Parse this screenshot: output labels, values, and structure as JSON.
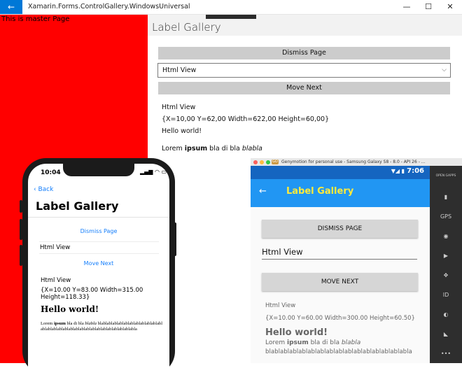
{
  "window": {
    "back_glyph": "←",
    "title": "Xamarin.Forms.ControlGallery.WindowsUniversal",
    "minimize_glyph": "—",
    "maximize_glyph": "☐",
    "close_glyph": "✕"
  },
  "master": {
    "text": "This is master Page"
  },
  "detail": {
    "title": "Label Gallery",
    "dismiss_label": "Dismiss Page",
    "picker_value": "Html View",
    "picker_chevron": "⌵",
    "next_label": "Move Next",
    "label_title": "Html View",
    "label_bounds": "{X=10,00 Y=62,00 Width=622,00 Height=60,00}",
    "hello": "Hello world!",
    "lorem_pre": "Lorem ",
    "lorem_bold": "ipsum",
    "lorem_mid": " bla di bla ",
    "lorem_italic": "blabla"
  },
  "ios": {
    "time": "10:04",
    "status_icons": "▂▄▆ ◠ ▭",
    "back_label": "‹ Back",
    "title": "Label Gallery",
    "dismiss_label": "Dismiss Page",
    "picker_value": "Html View",
    "next_label": "Move Next",
    "label_title": "Html View",
    "label_bounds_1": "{X=10.00 Y=83.00 Width=315.00",
    "label_bounds_2": "Height=118.33}",
    "hello": "Hello world!",
    "lorem_pre": "Lorem ",
    "lorem_bold": "ipsum",
    "lorem_mid": " bla di bla ",
    "lorem_italic": "blabla",
    "bla_line": "blablablablablablablablablablablablablablablablablablablablablablablablablablablablabla"
  },
  "geny": {
    "logo": "GO",
    "title": "Genymotion for personal use - Samsung Galaxy S8 - 8.0 - API 26 - ...",
    "dot_colors": [
      "#fc605b",
      "#fdbc40",
      "#34c84a"
    ],
    "status_time": "7:06",
    "status_icons": "▼◢ ▮",
    "back_glyph": "←",
    "toolbar_title": "Label Gallery",
    "dismiss_label": "DISMISS PAGE",
    "picker_value": "Html View",
    "next_label": "MOVE NEXT",
    "label_title": "Html View",
    "label_bounds": "{X=10.00 Y=60.00 Width=300.00 Height=60.50}",
    "hello": "Hello world!",
    "lorem_pre": "Lorem ",
    "lorem_bold": "ipsum",
    "lorem_mid": " bla di bla ",
    "lorem_italic": "blabla",
    "bla_line": "blablablablablablablablablablablablablablablabla",
    "tools": [
      {
        "name": "open-gapps-icon",
        "glyph": "OPEN GAPPS"
      },
      {
        "name": "battery-icon",
        "glyph": "▮"
      },
      {
        "name": "gps-icon",
        "glyph": "GPS"
      },
      {
        "name": "camera-icon",
        "glyph": "◉"
      },
      {
        "name": "video-icon",
        "glyph": "▶"
      },
      {
        "name": "dpad-icon",
        "glyph": "✥"
      },
      {
        "name": "id-icon",
        "glyph": "ID"
      },
      {
        "name": "phone-icon",
        "glyph": "◐"
      },
      {
        "name": "rss-icon",
        "glyph": "◣"
      },
      {
        "name": "more-icon",
        "glyph": "•••"
      }
    ]
  }
}
